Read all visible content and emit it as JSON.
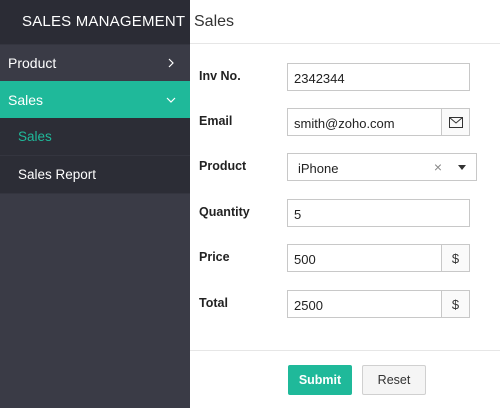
{
  "sidebar": {
    "brand": "SALES MANAGEMENT",
    "items": [
      {
        "label": "Product"
      },
      {
        "label": "Sales"
      }
    ],
    "sub_items": [
      {
        "label": "Sales"
      },
      {
        "label": "Sales Report"
      }
    ]
  },
  "header": {
    "title": "Sales"
  },
  "form": {
    "inv_no": {
      "label": "Inv No.",
      "value": "2342344"
    },
    "email": {
      "label": "Email",
      "value": "smith@zoho.com",
      "addon_icon": "envelope-icon"
    },
    "product": {
      "label": "Product",
      "value": "iPhone",
      "clear": "×"
    },
    "quantity": {
      "label": "Quantity",
      "value": "5"
    },
    "price": {
      "label": "Price",
      "value": "500",
      "addon": "$"
    },
    "total": {
      "label": "Total",
      "value": "2500",
      "addon": "$"
    }
  },
  "actions": {
    "submit": "Submit",
    "reset": "Reset"
  },
  "colors": {
    "accent": "#1fb99a",
    "sidebar": "#3a3b46",
    "sidebar_dark": "#2b2c35"
  }
}
